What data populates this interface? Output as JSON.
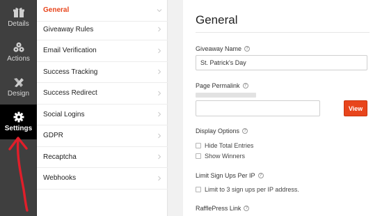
{
  "rail": {
    "items": [
      {
        "label": "Details",
        "icon": "gift-icon"
      },
      {
        "label": "Actions",
        "icon": "actions-icon"
      },
      {
        "label": "Design",
        "icon": "design-icon"
      },
      {
        "label": "Settings",
        "icon": "gear-icon",
        "active": true
      }
    ]
  },
  "menu": {
    "items": [
      {
        "label": "General",
        "active": true
      },
      {
        "label": "Giveaway Rules"
      },
      {
        "label": "Email Verification"
      },
      {
        "label": "Success Tracking"
      },
      {
        "label": "Success Redirect"
      },
      {
        "label": "Social Logins"
      },
      {
        "label": "GDPR"
      },
      {
        "label": "Recaptcha"
      },
      {
        "label": "Webhooks"
      }
    ]
  },
  "panel": {
    "title": "General",
    "giveaway_name": {
      "label": "Giveaway Name",
      "value": "St. Patrick's Day"
    },
    "page_permalink": {
      "label": "Page Permalink",
      "value": "",
      "button": "View"
    },
    "display_options": {
      "label": "Display Options",
      "options": [
        "Hide Total Entries",
        "Show Winners"
      ]
    },
    "limit_signups": {
      "label": "Limit Sign Ups Per IP",
      "option": "Limit to 3 sign ups per IP address."
    },
    "rafflepress_link": {
      "label": "RafflePress Link"
    }
  },
  "colors": {
    "accent": "#e8451c",
    "rail_bg": "#3f3f3f",
    "annotation": "#e01e2a"
  }
}
